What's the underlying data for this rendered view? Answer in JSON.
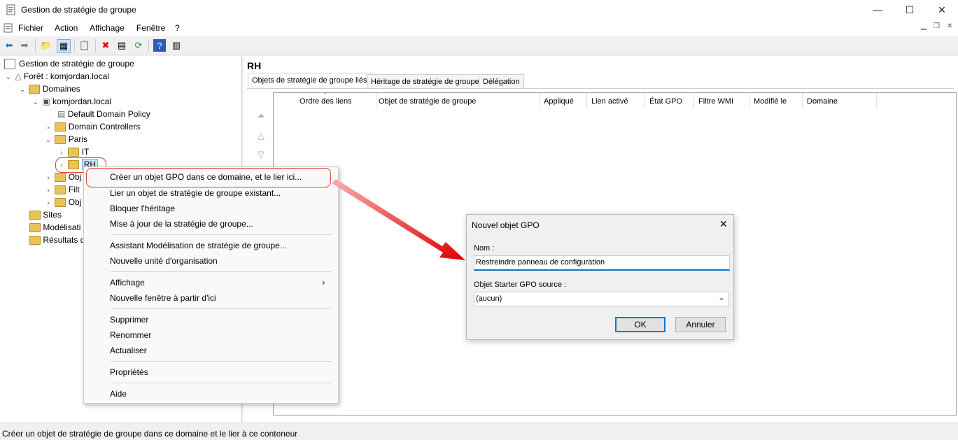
{
  "window": {
    "title": "Gestion de stratégie de groupe",
    "min": "—",
    "max": "☐",
    "close": "✕"
  },
  "menu": {
    "items": [
      "Fichier",
      "Action",
      "Affichage",
      "Fenêtre",
      "?"
    ]
  },
  "tree": {
    "root": "Gestion de stratégie de groupe",
    "forest": "Forêt : komjordan.local",
    "domains": "Domaines",
    "domain": "komjordan.local",
    "ddp": "Default Domain Policy",
    "dc": "Domain Controllers",
    "paris": "Paris",
    "it": "IT",
    "rh": "RH",
    "obj1": "Obj",
    "filt": "Filt",
    "obj2": "Obj",
    "sites": "Sites",
    "modeling": "Modélisati",
    "results": "Résultats d"
  },
  "right": {
    "title": "RH",
    "tabs": [
      "Objets de stratégie de groupe liés",
      "Héritage de stratégie de groupe",
      "Délégation"
    ],
    "columns": [
      "Ordre des liens",
      "Objet de stratégie de groupe",
      "Appliqué",
      "Lien activé",
      "État GPO",
      "Filtre WMI",
      "Modifié le",
      "Domaine"
    ]
  },
  "context_menu": {
    "items": [
      "Créer un objet GPO dans ce domaine, et le lier ici...",
      "Lier un objet de stratégie de groupe existant...",
      "Bloquer l'héritage",
      "Mise à jour de la stratégie de groupe...",
      "Assistant Modélisation de stratégie de groupe...",
      "Nouvelle unité d'organisation",
      "Affichage",
      "Nouvelle fenêtre à partir d'ici",
      "Supprimer",
      "Renommer",
      "Actualiser",
      "Propriétés",
      "Aide"
    ]
  },
  "dialog": {
    "title": "Nouvel objet GPO",
    "name_label": "Nom :",
    "name_value": "Restreindre panneau de configuration",
    "starter_label": "Objet Starter GPO source :",
    "starter_value": "(aucun)",
    "ok": "OK",
    "cancel": "Annuler"
  },
  "status": "Créer un objet de stratégie de groupe dans ce domaine et le lier à ce conteneur",
  "colors": {
    "highlight": "#e04040",
    "selection": "#cce8ff",
    "accent": "#0078d7"
  }
}
